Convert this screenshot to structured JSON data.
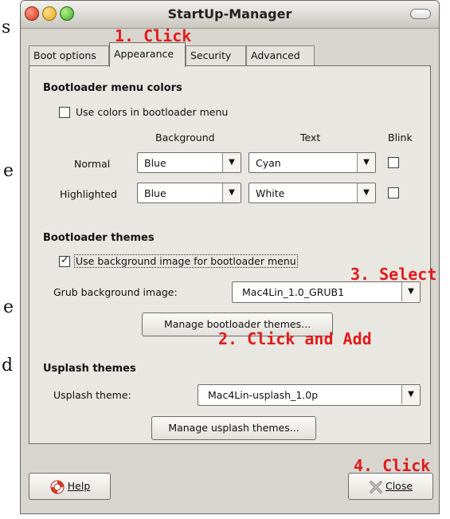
{
  "background_fragments": [
    "s",
    "e",
    "e",
    "d"
  ],
  "window": {
    "title": "StartUp-Manager"
  },
  "tabs": [
    {
      "label": "Boot options"
    },
    {
      "label": "Appearance"
    },
    {
      "label": "Security"
    },
    {
      "label": "Advanced"
    }
  ],
  "active_tab": "Appearance",
  "annotations": {
    "step1": "1. Click",
    "step2": "2. Click and Add",
    "step3": "3. Select",
    "step4": "4. Click"
  },
  "bootloader_colors": {
    "heading": "Bootloader menu colors",
    "use_colors_label": "Use colors in bootloader menu",
    "use_colors_checked": false,
    "col_background": "Background",
    "col_text": "Text",
    "col_blink": "Blink",
    "rows": [
      {
        "label": "Normal",
        "background": "Blue",
        "text": "Cyan",
        "blink": false
      },
      {
        "label": "Highlighted",
        "background": "Blue",
        "text": "White",
        "blink": false
      }
    ]
  },
  "bootloader_themes": {
    "heading": "Bootloader themes",
    "use_bg_image_label": "Use background image for bootloader menu",
    "use_bg_image_checked": true,
    "grub_bg_label": "Grub background image:",
    "grub_bg_value": "Mac4Lin_1.0_GRUB1",
    "manage_button": "Manage bootloader themes..."
  },
  "usplash_themes": {
    "heading": "Usplash themes",
    "theme_label": "Usplash theme:",
    "theme_value": "Mac4Lin-usplash_1.0p",
    "manage_button": "Manage usplash themes..."
  },
  "footer": {
    "help_label": "Help",
    "close_label": "Close"
  },
  "colors": {
    "annotation": "#e01b1b",
    "window_bg": "#d8d5cf",
    "panel_bg": "#e9e7e2"
  },
  "icons": {
    "help": "lifebuoy-icon",
    "close": "close-x-icon"
  }
}
